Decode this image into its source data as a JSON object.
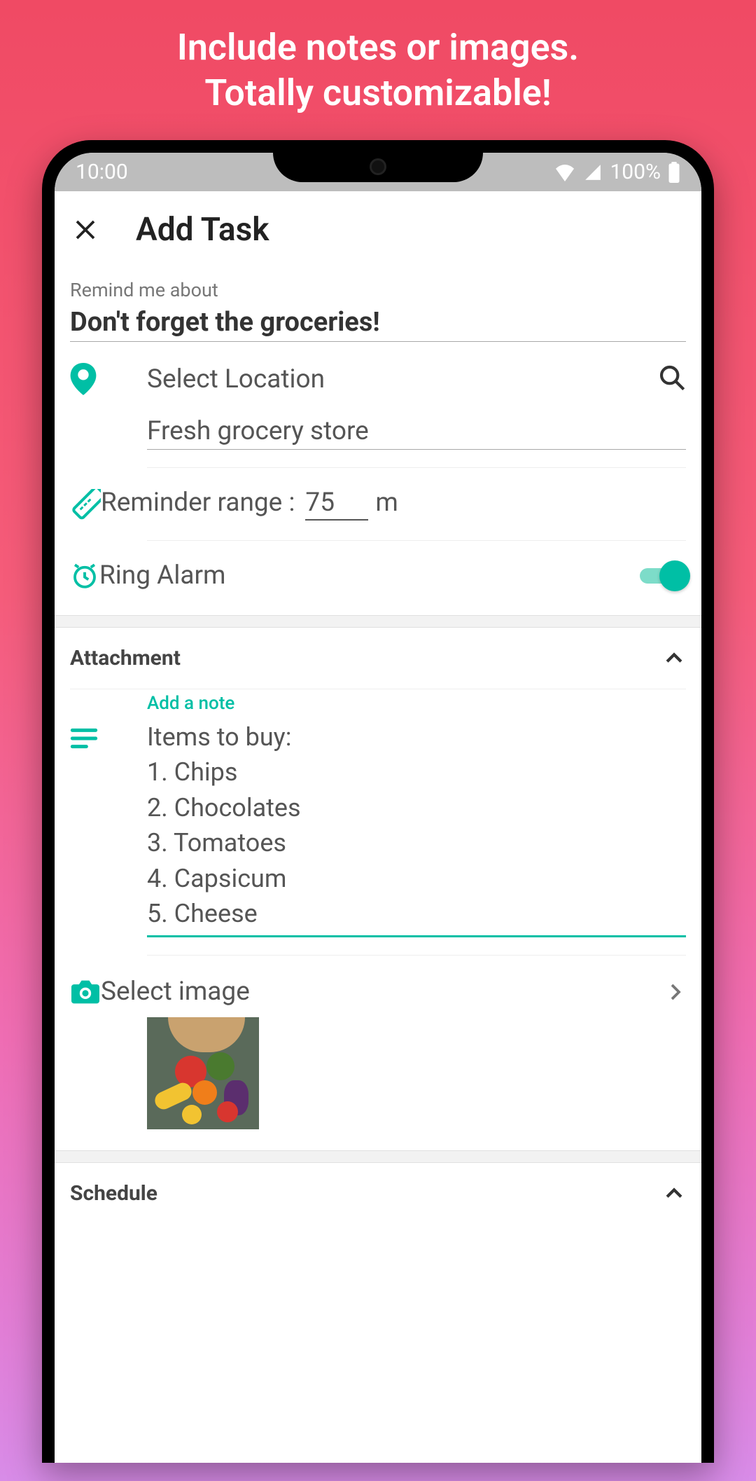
{
  "promo": {
    "line1": "Include notes or images.",
    "line2": "Totally customizable!"
  },
  "status": {
    "time": "10:00",
    "battery": "100%"
  },
  "header": {
    "title": "Add Task"
  },
  "task": {
    "remind_label": "Remind me about",
    "remind_value": "Don't forget the groceries!"
  },
  "location": {
    "select_label": "Select Location",
    "value": "Fresh grocery store"
  },
  "range": {
    "prefix": "Reminder range :",
    "value": "75",
    "unit": "m"
  },
  "alarm": {
    "label": "Ring Alarm",
    "enabled": true
  },
  "attachment": {
    "header": "Attachment",
    "note_label": "Add a note",
    "note_value": "Items to buy:\n1. Chips\n2. Chocolates\n3. Tomatoes\n4. Capsicum\n5. Cheese",
    "image_label": "Select image"
  },
  "schedule": {
    "header": "Schedule"
  },
  "colors": {
    "accent": "#00bfa5"
  }
}
